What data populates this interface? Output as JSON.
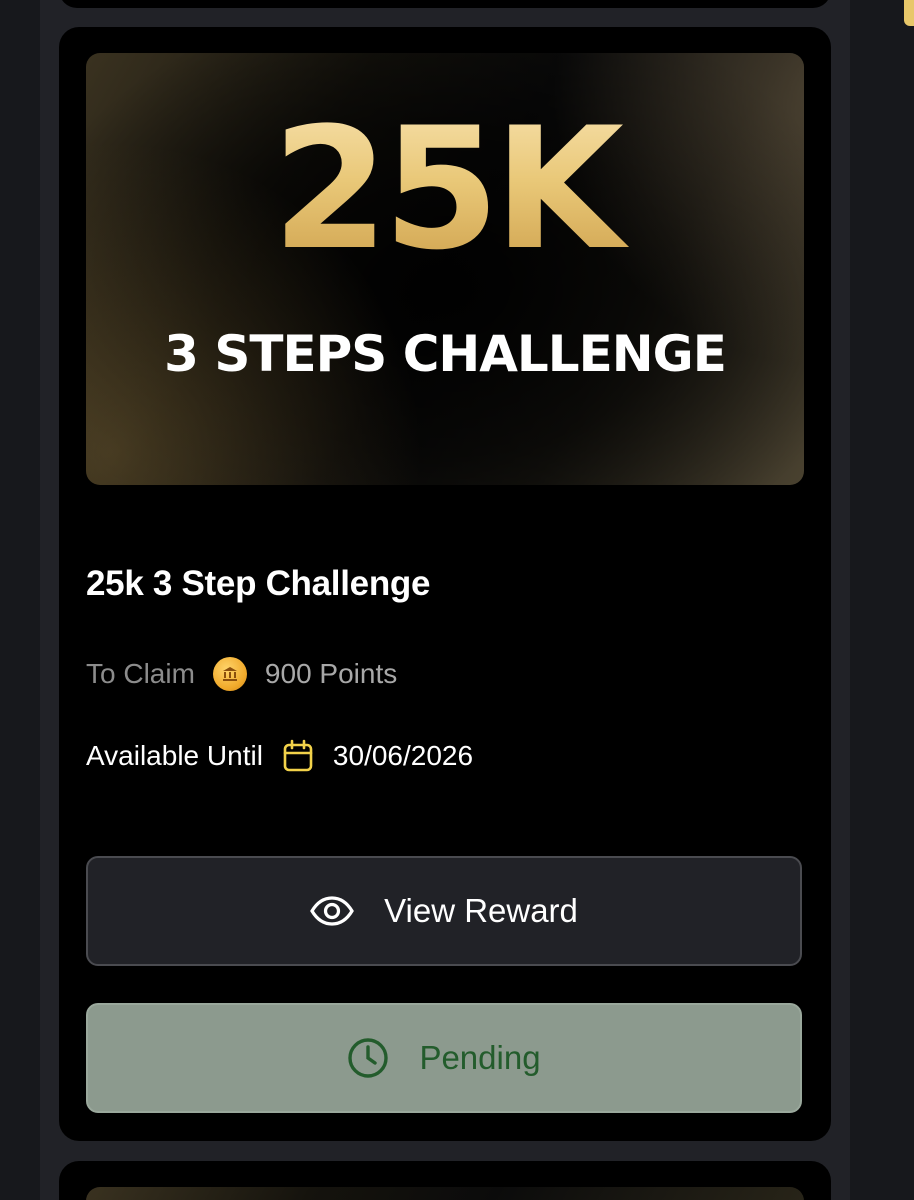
{
  "banner": {
    "amount": "25K",
    "subtitle": "3 STEPS CHALLENGE"
  },
  "reward": {
    "title": "25k 3 Step Challenge",
    "claim_label": "To Claim",
    "claim_value": "900 Points",
    "until_label": "Available Until",
    "until_value": "30/06/2026"
  },
  "actions": {
    "view_label": "View Reward",
    "status_label": "Pending"
  },
  "icons": {
    "coin": "coin-icon",
    "calendar": "calendar-icon",
    "eye": "eye-icon",
    "clock": "clock-icon"
  },
  "colors": {
    "accent_gold": "#e9c878",
    "pending_bg": "#8c9a8e",
    "pending_text": "#235c2c",
    "calendar_icon": "#f2d24a"
  }
}
